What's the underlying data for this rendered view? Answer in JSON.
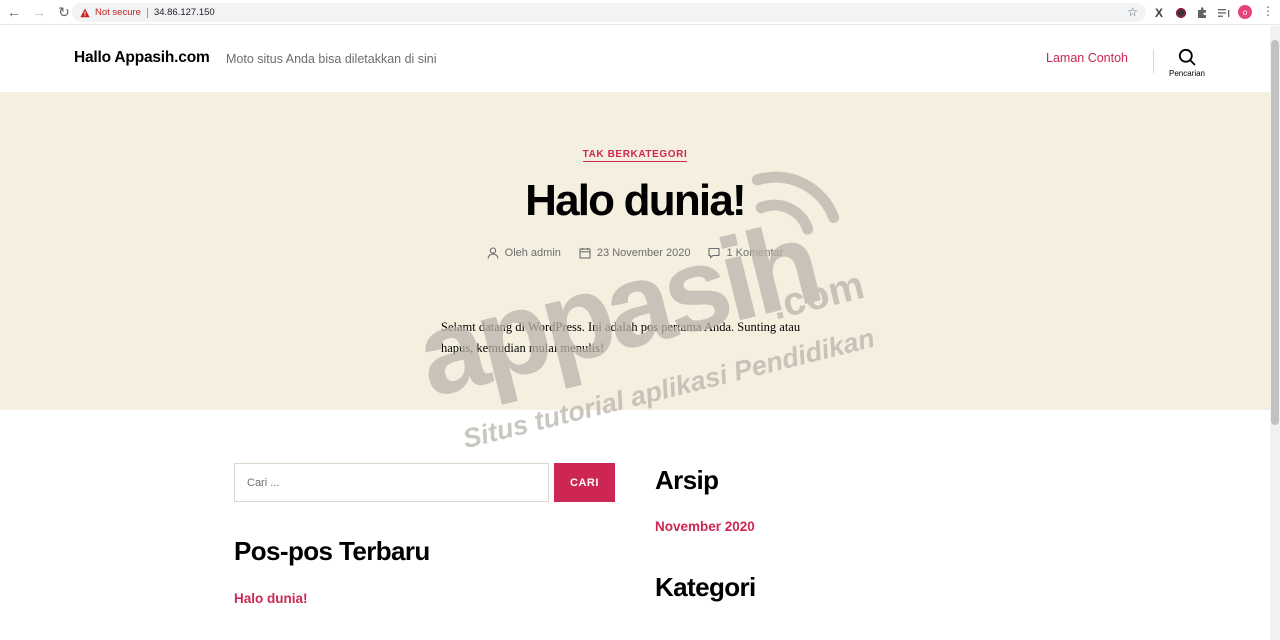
{
  "browser": {
    "security_label": "Not secure",
    "url": "34.86.127.150",
    "profile_initial": "o"
  },
  "site": {
    "title": "Hallo Appasih.com",
    "description": "Moto situs Anda bisa diletakkan di sini",
    "menu": [
      "Laman Contoh"
    ],
    "search_label": "Pencarian"
  },
  "post": {
    "category": "TAK BERKATEGORI",
    "title": "Halo dunia!",
    "author": "Oleh admin",
    "date": "23 November 2020",
    "comments": "1 Komentar",
    "content": "Selamt datang di WordPress. Ini adalah pos pertama Anda. Sunting atau hapus, kemudian mulai menulis!"
  },
  "widgets": {
    "search": {
      "placeholder": "Cari ...",
      "button": "CARI"
    },
    "recent_posts": {
      "title": "Pos-pos Terbaru",
      "items": [
        "Halo dunia!"
      ]
    },
    "archives": {
      "title": "Arsip",
      "items": [
        "November 2020"
      ]
    },
    "categories": {
      "title": "Kategori"
    }
  },
  "watermark": {
    "brand": "appasih",
    "domain": ".com",
    "tagline": "Situs tutorial aplikasi Pendidikan"
  },
  "colors": {
    "accent": "#cd2653",
    "hero_bg": "#f5efe0",
    "muted_text": "#6d6d6d"
  }
}
